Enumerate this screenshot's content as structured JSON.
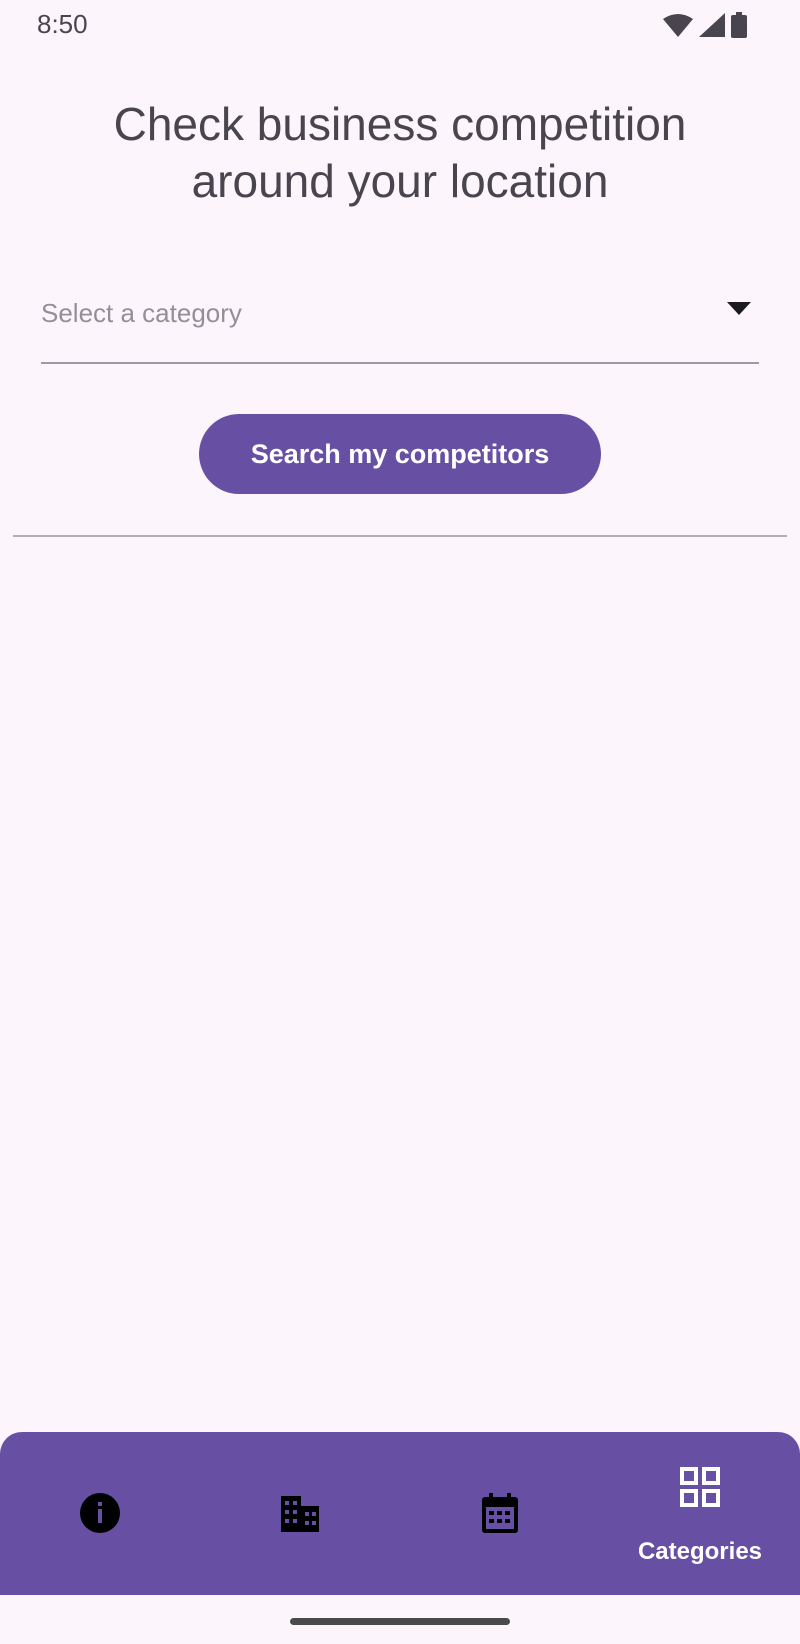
{
  "status_bar": {
    "time": "8:50",
    "icons": [
      "wifi-icon",
      "signal-icon",
      "battery-icon"
    ]
  },
  "header": {
    "title_line1": "Check business competition",
    "title_line2": "around your location"
  },
  "category_select": {
    "placeholder": "Select a category",
    "icon": "dropdown-caret-icon"
  },
  "search": {
    "button_label": "Search my competitors"
  },
  "bottom_nav": {
    "items": [
      {
        "icon": "info-icon",
        "label": ""
      },
      {
        "icon": "building-icon",
        "label": ""
      },
      {
        "icon": "calendar-icon",
        "label": ""
      },
      {
        "icon": "grid-icon",
        "label": "Categories",
        "selected": true
      }
    ]
  },
  "colors": {
    "background": "#FCF6FC",
    "primary": "#6750A4",
    "text": "#49454F",
    "placeholder": "#938F99",
    "on_primary": "#FFFFFF"
  }
}
